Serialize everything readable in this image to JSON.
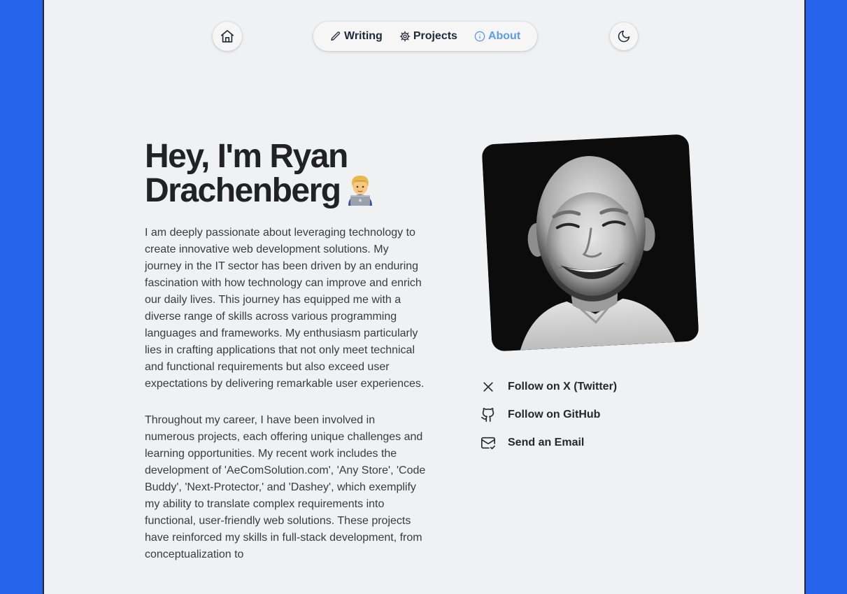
{
  "nav": {
    "home_icon": "home-icon",
    "items": [
      {
        "label": "Writing",
        "icon": "pencil-icon"
      },
      {
        "label": "Projects",
        "icon": "gear-icon"
      },
      {
        "label": "About",
        "icon": "info-icon"
      }
    ],
    "active_item": "About",
    "theme_icon": "moon-icon"
  },
  "hero": {
    "heading": "Hey, I'm Ryan Drachenberg",
    "emoji": "👨‍💻"
  },
  "bio": {
    "paragraphs": [
      "I am deeply passionate about leveraging technology to create innovative web development solutions. My journey in the IT sector has been driven by an enduring fascination with how technology can improve and enrich our daily lives. This journey has equipped me with a diverse range of skills across various programming languages and frameworks. My enthusiasm particularly lies in crafting applications that not only meet technical and functional requirements but also exceed user expectations by delivering remarkable user experiences.",
      "Throughout my career, I have been involved in numerous projects, each offering unique challenges and learning opportunities. My recent work includes the development of 'AeComSolution.com', 'Any Store', 'Code Buddy', 'Next-Protector,' and 'Dashey', which exemplify my ability to translate complex requirements into functional, user-friendly web solutions. These projects have reinforced my skills in full-stack development, from conceptualization to"
    ]
  },
  "portrait": {
    "description_icon": "profile-photo"
  },
  "socials": [
    {
      "label": "Follow on X (Twitter)",
      "icon": "x-icon"
    },
    {
      "label": "Follow on GitHub",
      "icon": "github-icon"
    },
    {
      "label": "Send an Email",
      "icon": "mail-check-icon"
    }
  ],
  "colors": {
    "page_bg": "#2563eb",
    "content_bg": "#f0f1f3",
    "accent": "#5b9bf0",
    "text": "#27272a"
  }
}
